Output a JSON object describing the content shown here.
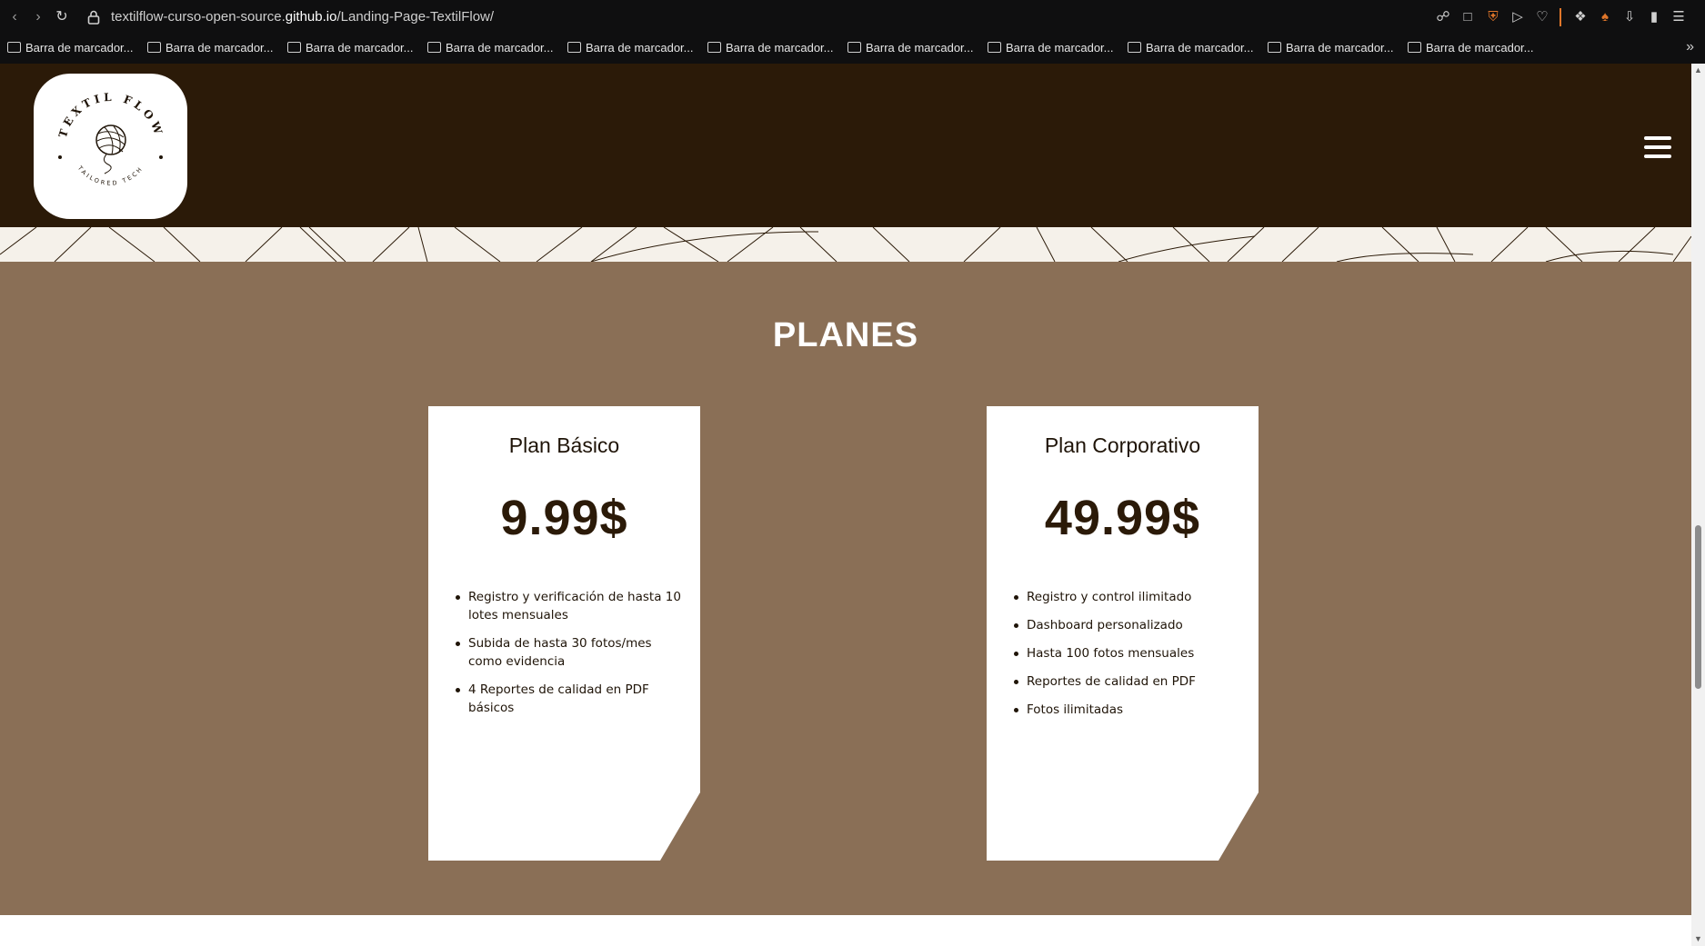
{
  "browser": {
    "url_prefix": "textilflow-curso-open-source.",
    "url_domain": "github.io",
    "url_path": "/Landing-Page-TextilFlow/",
    "bookmarks": [
      "Barra de marcador...",
      "Barra de marcador...",
      "Barra de marcador...",
      "Barra de marcador...",
      "Barra de marcador...",
      "Barra de marcador...",
      "Barra de marcador...",
      "Barra de marcador...",
      "Barra de marcador...",
      "Barra de marcador...",
      "Barra de marcador..."
    ]
  },
  "header": {
    "logo_text_top": "TEXTIL FLOW",
    "logo_text_bottom": "TAILORED TECH",
    "menu_icon": "hamburger-icon"
  },
  "plans": {
    "title": "PLANES",
    "cards": [
      {
        "name": "Plan Básico",
        "price": "9.99$",
        "features": [
          "Registro y verificación de hasta 10 lotes mensuales",
          "Subida de hasta 30 fotos/mes como evidencia",
          "4 Reportes de calidad en PDF básicos"
        ]
      },
      {
        "name": "Plan Corporativo",
        "price": "49.99$",
        "features": [
          "Registro y control ilimitado",
          "Dashboard personalizado",
          "Hasta 100 fotos mensuales",
          "Reportes de calidad en PDF",
          "Fotos ilimitadas"
        ]
      }
    ]
  },
  "colors": {
    "header_bg": "#2b1a08",
    "section_bg": "#8a6f56",
    "pattern_bg": "#f5f1ea",
    "price_color": "#2b1a08"
  }
}
